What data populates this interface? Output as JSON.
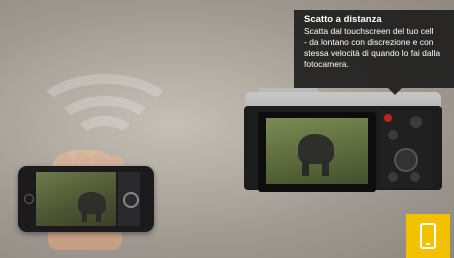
{
  "tooltip": {
    "title": "Scatto a distanza",
    "body": "Scatta dal touchscreen del tuo cell\n- da lontano con discrezione e con\nstessa velocità di quando lo fai dalla\nfotocamera."
  },
  "colors": {
    "accent": "#f2c200",
    "tooltip_bg": "#1c1c1c"
  },
  "icons": {
    "smartphone_button": "smartphone-icon"
  }
}
